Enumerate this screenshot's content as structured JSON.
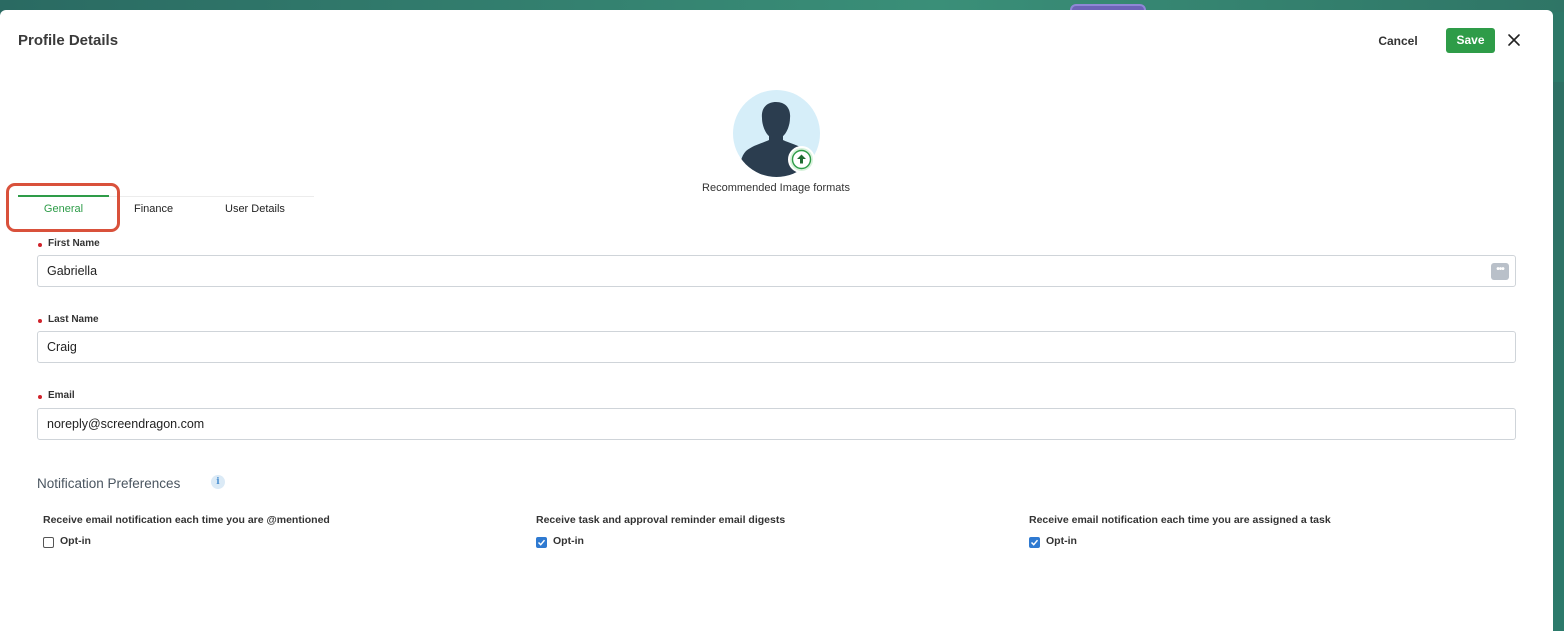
{
  "header": {
    "title": "Profile Details",
    "cancel_label": "Cancel",
    "save_label": "Save"
  },
  "avatar": {
    "hint": "Recommended Image formats"
  },
  "tabs": [
    {
      "label": "General",
      "active": true
    },
    {
      "label": "Finance",
      "active": false
    },
    {
      "label": "User Details",
      "active": false
    }
  ],
  "form": {
    "first_name": {
      "label": "First Name",
      "value": "Gabriella",
      "required": true
    },
    "last_name": {
      "label": "Last Name",
      "value": "Craig",
      "required": true
    },
    "email": {
      "label": "Email",
      "value": "noreply@screendragon.com",
      "required": true
    },
    "ellipsis": "•••"
  },
  "notifications": {
    "title": "Notification Preferences",
    "info": "i",
    "items": [
      {
        "label": "Receive email notification each time you are @mentioned",
        "option": "Opt-in",
        "checked": false
      },
      {
        "label": "Receive task and approval reminder email digests",
        "option": "Opt-in",
        "checked": true
      },
      {
        "label": "Receive email notification each time you are assigned a task",
        "option": "Opt-in",
        "checked": true
      }
    ]
  },
  "colors": {
    "accent": "#2e9c48",
    "highlight": "#d9513b",
    "required": "#d0232b",
    "checkbox": "#2f7ad1"
  }
}
